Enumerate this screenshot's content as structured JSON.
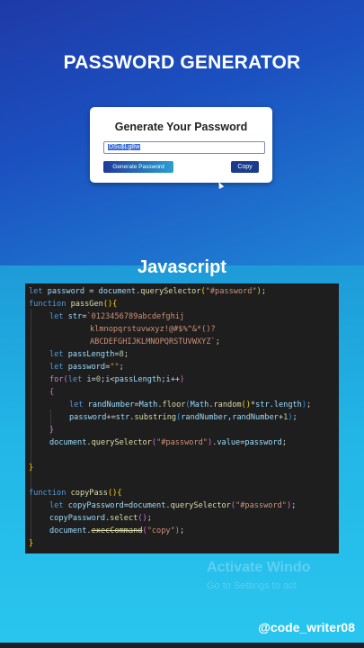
{
  "header": {
    "title": "PASSWORD GENERATOR"
  },
  "card": {
    "title": "Generate Your Password",
    "password_value": "DSu$Lg8w",
    "generate_label": "Generate Password",
    "copy_label": "Copy"
  },
  "section": {
    "title": "Javascript"
  },
  "code": {
    "lines": [
      "let password = document.querySelector(\"#password\");",
      "function passGen(){",
      "    let str=`0123456789abcdefghij",
      "            klmnopqrstuvwxyz!@#$%^&*()?",
      "            ABCDEFGHIJKLMNOPQRSTUVWXYZ`;",
      "    let passLength=8;",
      "    let password=\"\";",
      "    for(let i=0;i<passLength;i++)",
      "    {",
      "        let randNumber=Math.floor(Math.random()*str.length);",
      "        password+=str.substring(randNumber,randNumber+1);",
      "    }",
      "    document.querySelector(\"#password\").value=password;",
      "",
      "}",
      "",
      "",
      "function copyPass(){",
      "    let copyPassword=document.querySelector(\"#password\");",
      "    copyPassword.select();",
      "    document.execCommand(\"copy\");",
      "}"
    ]
  },
  "watermark": {
    "line1": "Activate Windo",
    "line2": "Go to Settings to act"
  },
  "footer": {
    "handle": "@code_writer08"
  },
  "colors": {
    "keyword": "#569cd6",
    "string": "#ce9178",
    "function": "#dcdcaa",
    "variable": "#9cdcfe",
    "control": "#c586c0",
    "editor_bg": "#1e1e1e"
  }
}
